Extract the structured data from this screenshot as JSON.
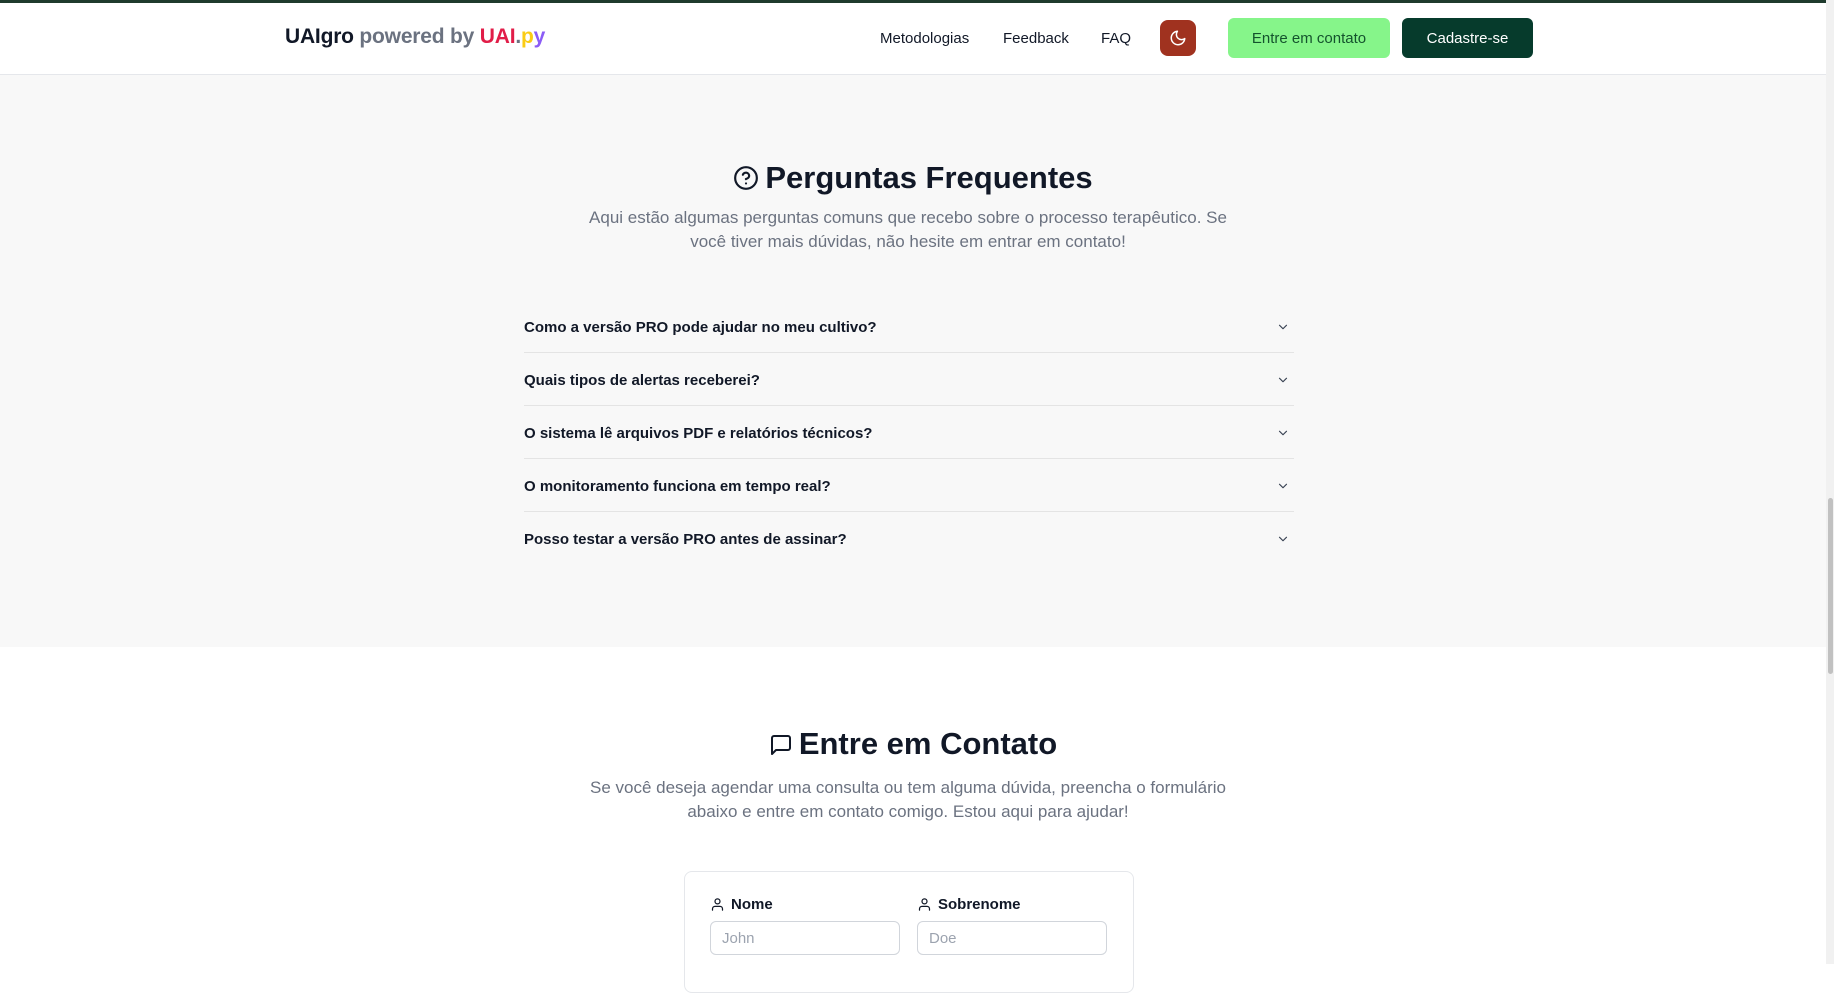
{
  "brand": {
    "name": "UAIgro",
    "powered_by": " powered by ",
    "uai": "UAI",
    "dot": ".",
    "p": "p",
    "y": "y"
  },
  "nav": {
    "links": [
      "Metodologias",
      "Feedback",
      "FAQ"
    ],
    "theme_icon": "moon-icon",
    "contact_button": "Entre em contato",
    "signup_button": "Cadastre-se"
  },
  "faq": {
    "icon": "help-circle-icon",
    "title": "Perguntas Frequentes",
    "subtitle": "Aqui estão algumas perguntas comuns que recebo sobre o processo terapêutico. Se você tiver mais dúvidas, não hesite em entrar em contato!",
    "items": [
      "Como a versão PRO pode ajudar no meu cultivo?",
      "Quais tipos de alertas receberei?",
      "O sistema lê arquivos PDF e relatórios técnicos?",
      "O monitoramento funciona em tempo real?",
      "Posso testar a versão PRO antes de assinar?"
    ]
  },
  "contact": {
    "icon": "message-square-icon",
    "title": "Entre em Contato",
    "subtitle": "Se você deseja agendar uma consulta ou tem alguma dúvida, preencha o formulário abaixo e entre em contato comigo. Estou aqui para ajudar!",
    "form": {
      "first_name_label": "Nome",
      "first_name_placeholder": "John",
      "last_name_label": "Sobrenome",
      "last_name_placeholder": "Doe"
    }
  },
  "colors": {
    "theme_button": "#a0321f",
    "contact_button": "#86f58a",
    "signup_button": "#063b2c",
    "brand_red": "#e11d48",
    "brand_yellow": "#facc15",
    "brand_purple": "#8b5cf6"
  }
}
